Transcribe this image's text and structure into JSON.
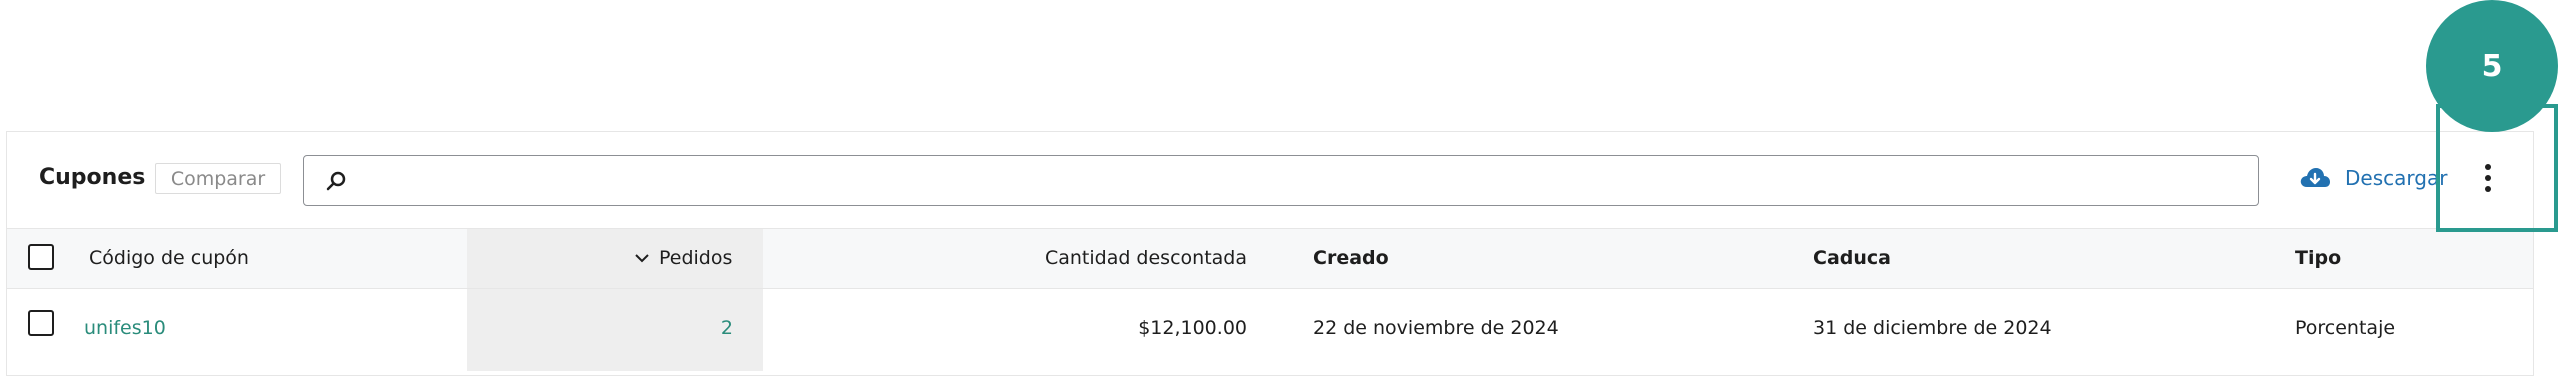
{
  "panel": {
    "title": "Cupones",
    "compare_label": "Comparar",
    "search": {
      "value": "",
      "placeholder": ""
    },
    "download_label": "Descargar"
  },
  "table": {
    "columns": {
      "code": "Código de cupón",
      "orders": "Pedidos",
      "discount": "Cantidad descontada",
      "created": "Creado",
      "expires": "Caduca",
      "type": "Tipo"
    },
    "rows": [
      {
        "code": "unifes10",
        "orders": "2",
        "discount": "$12,100.00",
        "created": "22 de noviembre de 2024",
        "expires": "31 de diciembre de 2024",
        "type": "Porcentaje"
      }
    ]
  },
  "tutorial": {
    "step": "5"
  },
  "icons": [
    "search-icon",
    "cloud-download-icon",
    "chevron-down-icon",
    "more-vertical-icon"
  ],
  "colors": {
    "accent": "#2a9a8f",
    "link": "#2a8c7b",
    "download": "#2271b1"
  }
}
